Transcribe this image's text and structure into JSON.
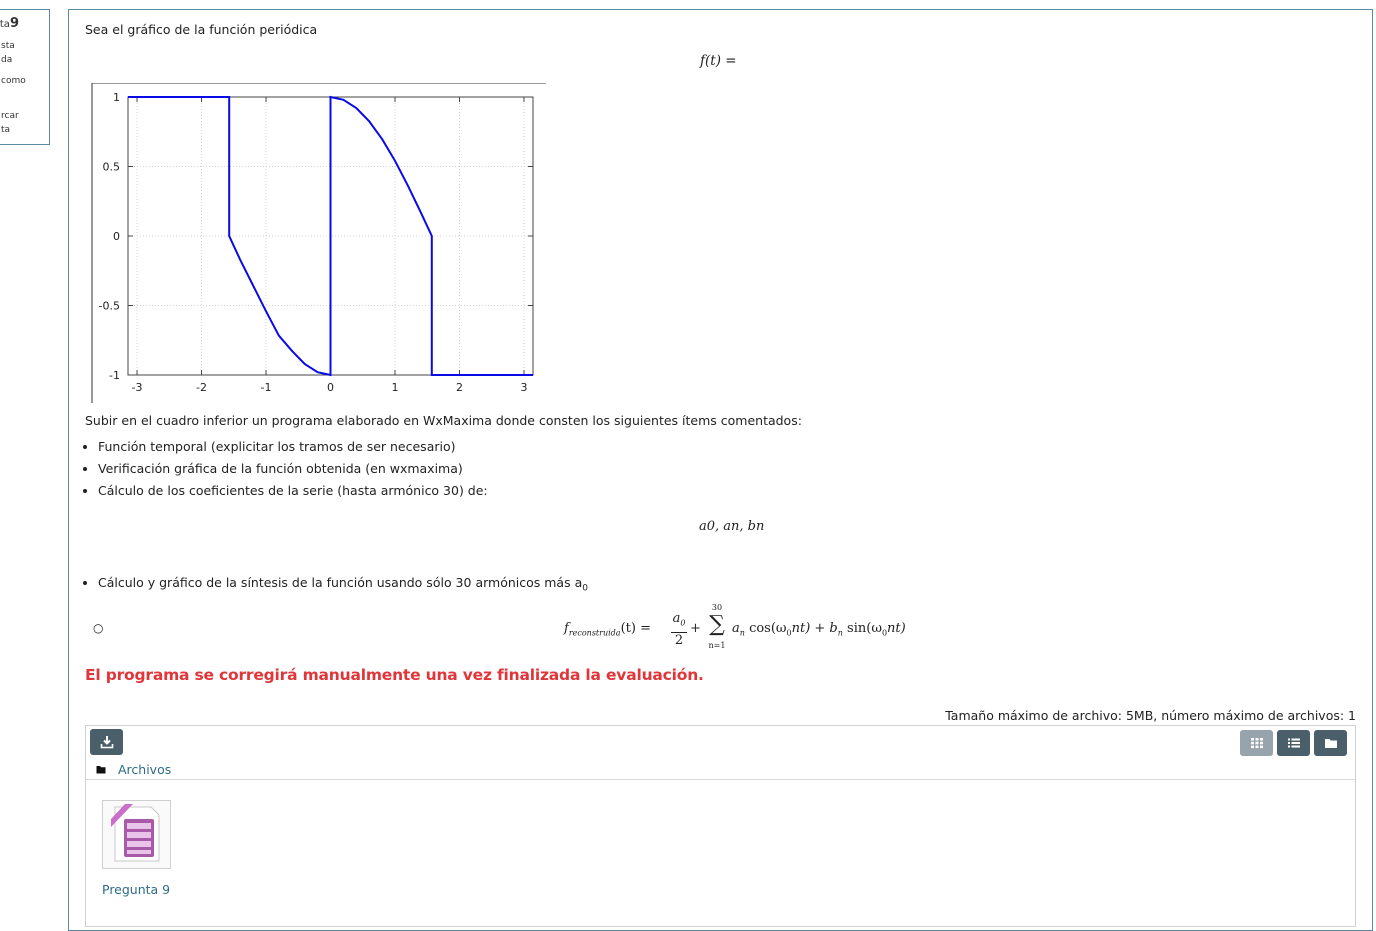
{
  "sidebar": {
    "question_prefix": "ta",
    "question_number": "9",
    "lines": [
      "sta",
      "da",
      "como",
      "rcar",
      "ta"
    ]
  },
  "question": {
    "intro": "Sea el gráfico de la función periódica",
    "formula_f": "f(t) =",
    "upload_instruction": "Subir en el cuadro inferior un programa elaborado en WxMaxima donde consten los siguientes ítems comentados:",
    "items": [
      "Función temporal (explicitar los tramos de ser necesario)",
      "Verificación gráfica de la función obtenida (en wxmaxima)",
      "Cálculo de los coeficientes de la serie (hasta armónico 30) de:"
    ],
    "coef_formula": "a0, an, bn",
    "synthesis_item": "Cálculo y gráfico de la síntesis de la función usando sólo 30 armónicos más a",
    "synthesis_subscript": "0",
    "reconstruction_formula": {
      "lhs": "f",
      "lhs_sub": "reconstruida",
      "arg": "(t) =",
      "frac_num": "a",
      "frac_num_sub": "0",
      "frac_den": "2",
      "plus": "+",
      "sum_top": "30",
      "sum_bottom": "n=1",
      "term": "a",
      "term_sub": "n",
      "cos": "cos(ω",
      "cos_sub": "0",
      "cos_rest": "nt) + b",
      "b_sub": "n",
      "sin": " sin(ω",
      "sin_sub": "0",
      "sin_rest": "nt)"
    },
    "warning": "El programa se corregirá manualmente una vez finalizada la evaluación."
  },
  "chart_data": {
    "type": "line",
    "title": "",
    "xlabel": "",
    "ylabel": "",
    "xlim": [
      -3.14,
      3.14
    ],
    "ylim": [
      -1,
      1
    ],
    "xticks": [
      "-3",
      "-2",
      "-1",
      "0",
      "1",
      "2",
      "3"
    ],
    "yticks": [
      "-1",
      "-0.5",
      "0",
      "0.5",
      "1"
    ],
    "grid": true,
    "line_color": "#0a0ae6",
    "series": [
      {
        "x": [
          -3.14,
          -1.571,
          -1.571,
          -1.4,
          -1.2,
          -1.0,
          -0.8,
          -0.6,
          -0.4,
          -0.2,
          0.0,
          0.0,
          0.2,
          0.4,
          0.6,
          0.8,
          1.0,
          1.2,
          1.4,
          1.571,
          1.571,
          3.14
        ],
        "y": [
          1,
          1,
          0,
          -0.171,
          -0.356,
          -0.541,
          -0.717,
          -0.825,
          -0.921,
          -0.98,
          -1,
          1,
          0.98,
          0.921,
          0.825,
          0.697,
          0.541,
          0.362,
          0.17,
          0,
          -1,
          -1
        ]
      }
    ]
  },
  "file_manager": {
    "max_size_text": "Tamaño máximo de archivo: 5MB, número máximo de archivos: 1",
    "breadcrumb": "Archivos",
    "file_name": "Pregunta 9",
    "icons": [
      "download-icon",
      "grid-view-icon",
      "list-view-icon",
      "folder-view-icon",
      "folder-icon",
      "document-icon"
    ]
  }
}
